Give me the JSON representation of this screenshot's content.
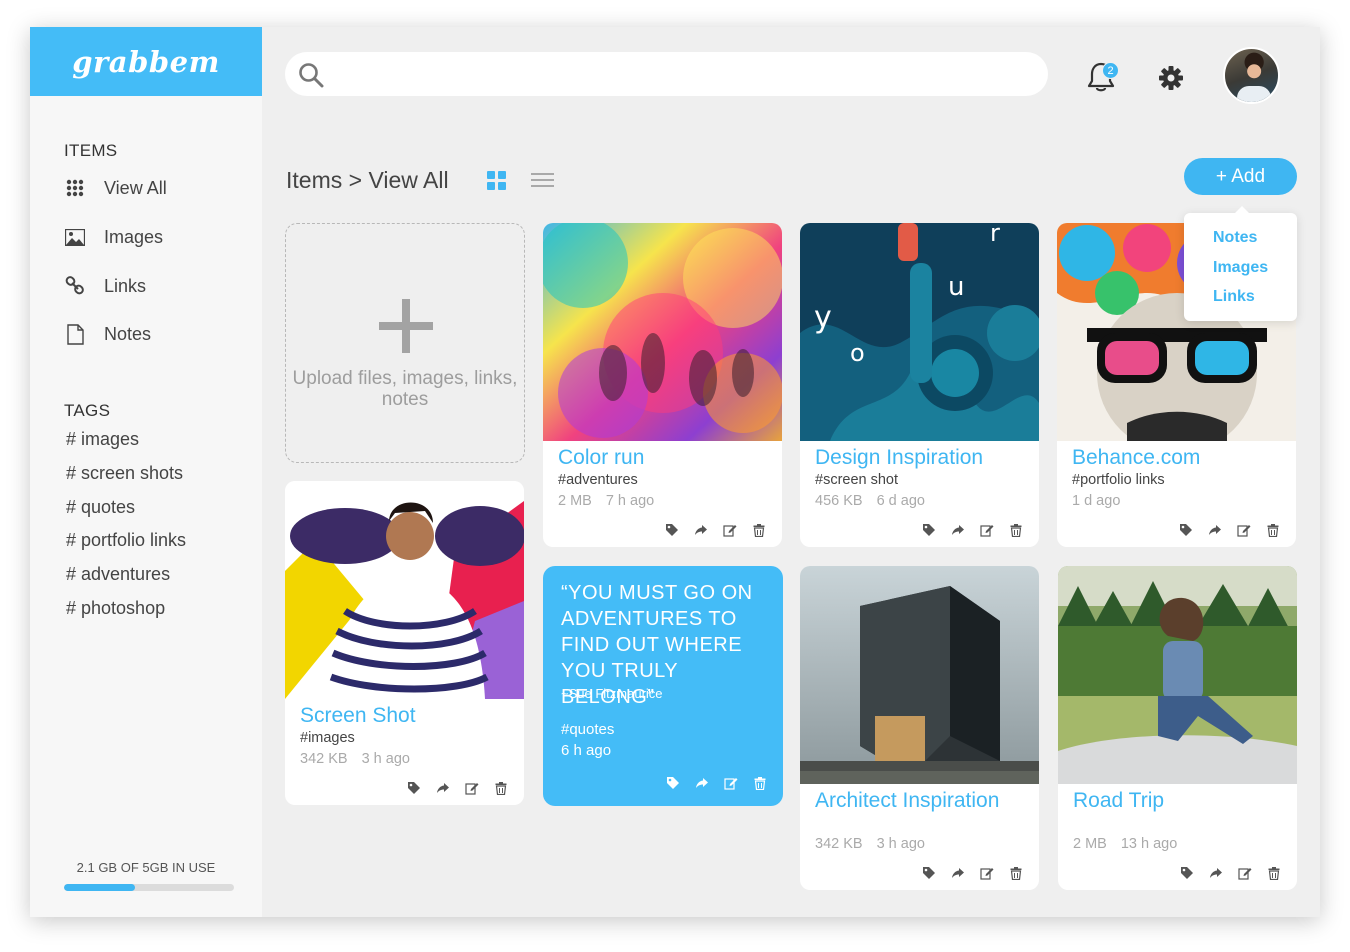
{
  "app": {
    "logo": "grabbem"
  },
  "sidebar": {
    "items_heading": "ITEMS",
    "nav": [
      {
        "label": "View All",
        "icon": "grid-dots-icon"
      },
      {
        "label": "Images",
        "icon": "image-icon"
      },
      {
        "label": "Links",
        "icon": "link-icon"
      },
      {
        "label": "Notes",
        "icon": "document-icon"
      }
    ],
    "tags_heading": "TAGS",
    "tags": [
      "# images",
      "# screen shots",
      "# quotes",
      "# portfolio links",
      "# adventures",
      "# photoshop"
    ],
    "storage": {
      "label": "2.1 GB OF 5GB IN USE",
      "used_fraction": 0.42
    }
  },
  "topbar": {
    "search_placeholder": "",
    "notification_count": "2",
    "icons": [
      "search-icon",
      "bell-icon",
      "gear-icon",
      "avatar"
    ]
  },
  "main": {
    "breadcrumb": "Items > View All",
    "view_modes": [
      "grid-view-icon",
      "list-view-icon"
    ],
    "add_button": "+ Add",
    "add_menu": [
      "Notes",
      "Images",
      "Links"
    ],
    "upload_text": "Upload files, images, links, notes",
    "cards": [
      {
        "title": "Color run",
        "tag": "#adventures",
        "size": "2 MB",
        "time": "7 h ago"
      },
      {
        "title": "Design Inspiration",
        "tag": "#screen shot",
        "size": "456 KB",
        "time": "6 d ago"
      },
      {
        "title": "Behance.com",
        "tag": "#portfolio links",
        "size": "",
        "time": "1 d ago"
      },
      {
        "title": "Screen Shot",
        "tag": "#images",
        "size": "342 KB",
        "time": "3 h ago"
      },
      {
        "title": "Architect Inspiration",
        "tag": "",
        "size": "342 KB",
        "time": "3 h ago"
      },
      {
        "title": "Road Trip",
        "tag": "",
        "size": "2 MB",
        "time": "13 h ago"
      }
    ],
    "quote_card": {
      "text": "“YOU MUST GO ON ADVENTURES TO FIND OUT WHERE YOU TRULY BELONG”",
      "author": "~Sue Fitzmaurice",
      "tag": "#quotes",
      "time": "6 h ago"
    },
    "card_actions": [
      "tag-icon",
      "share-icon",
      "edit-icon",
      "trash-icon"
    ]
  },
  "colors": {
    "accent": "#3fb6f2",
    "logo_bg": "#44bcf7",
    "background": "#efefef"
  }
}
